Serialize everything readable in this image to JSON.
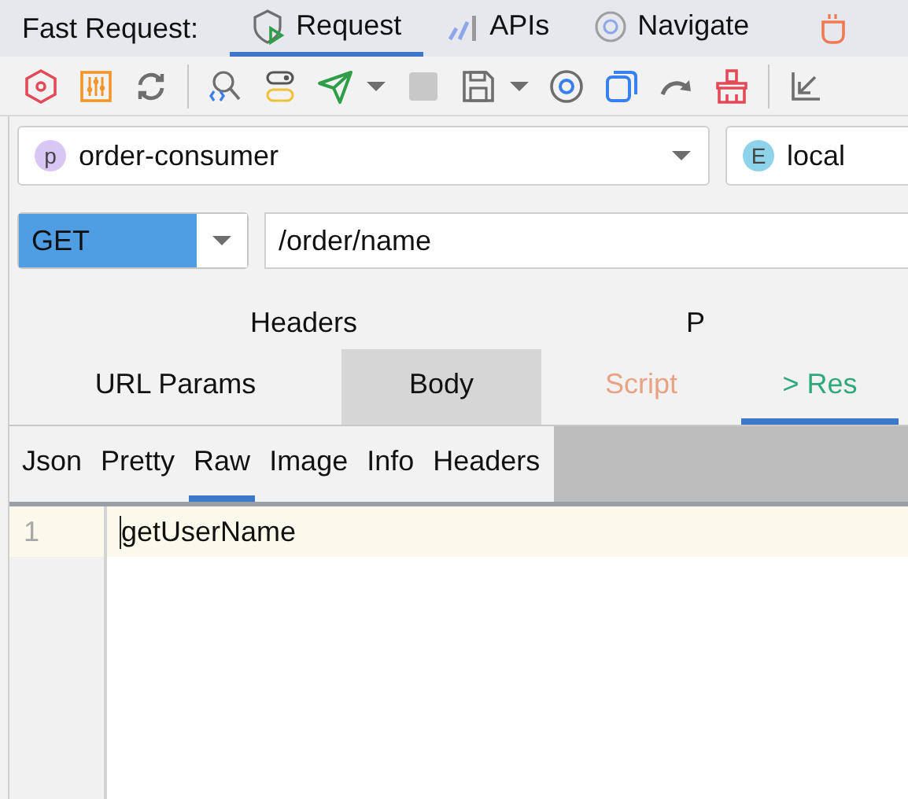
{
  "plugin_bar": {
    "label": "Fast Request:",
    "tabs": [
      {
        "label": "Request",
        "selected": true
      },
      {
        "label": "APIs",
        "selected": false
      },
      {
        "label": "Navigate",
        "selected": false
      }
    ]
  },
  "project_selector": {
    "badge": "p",
    "value": "order-consumer"
  },
  "env_selector": {
    "badge": "E",
    "value": "local"
  },
  "method": {
    "value": "GET"
  },
  "url": {
    "value": "/order/name"
  },
  "header_tabs": [
    "Headers",
    "P"
  ],
  "request_tabs": [
    {
      "label": "URL Params",
      "kind": "tab",
      "selected": false
    },
    {
      "label": "Body",
      "kind": "tab",
      "selected": true
    },
    {
      "label": "Script",
      "kind": "tab",
      "selected": false,
      "color": "#e9a283"
    },
    {
      "label": "> Res",
      "kind": "toggle",
      "selected": true,
      "color": "#2fa97c"
    }
  ],
  "response_tabs": [
    {
      "label": "Json",
      "selected": false
    },
    {
      "label": "Pretty",
      "selected": false
    },
    {
      "label": "Raw",
      "selected": true
    },
    {
      "label": "Image",
      "selected": false
    },
    {
      "label": "Info",
      "selected": false
    },
    {
      "label": "Headers",
      "selected": false
    }
  ],
  "editor": {
    "lines": [
      {
        "number": "1",
        "text": "getUserName"
      }
    ]
  }
}
